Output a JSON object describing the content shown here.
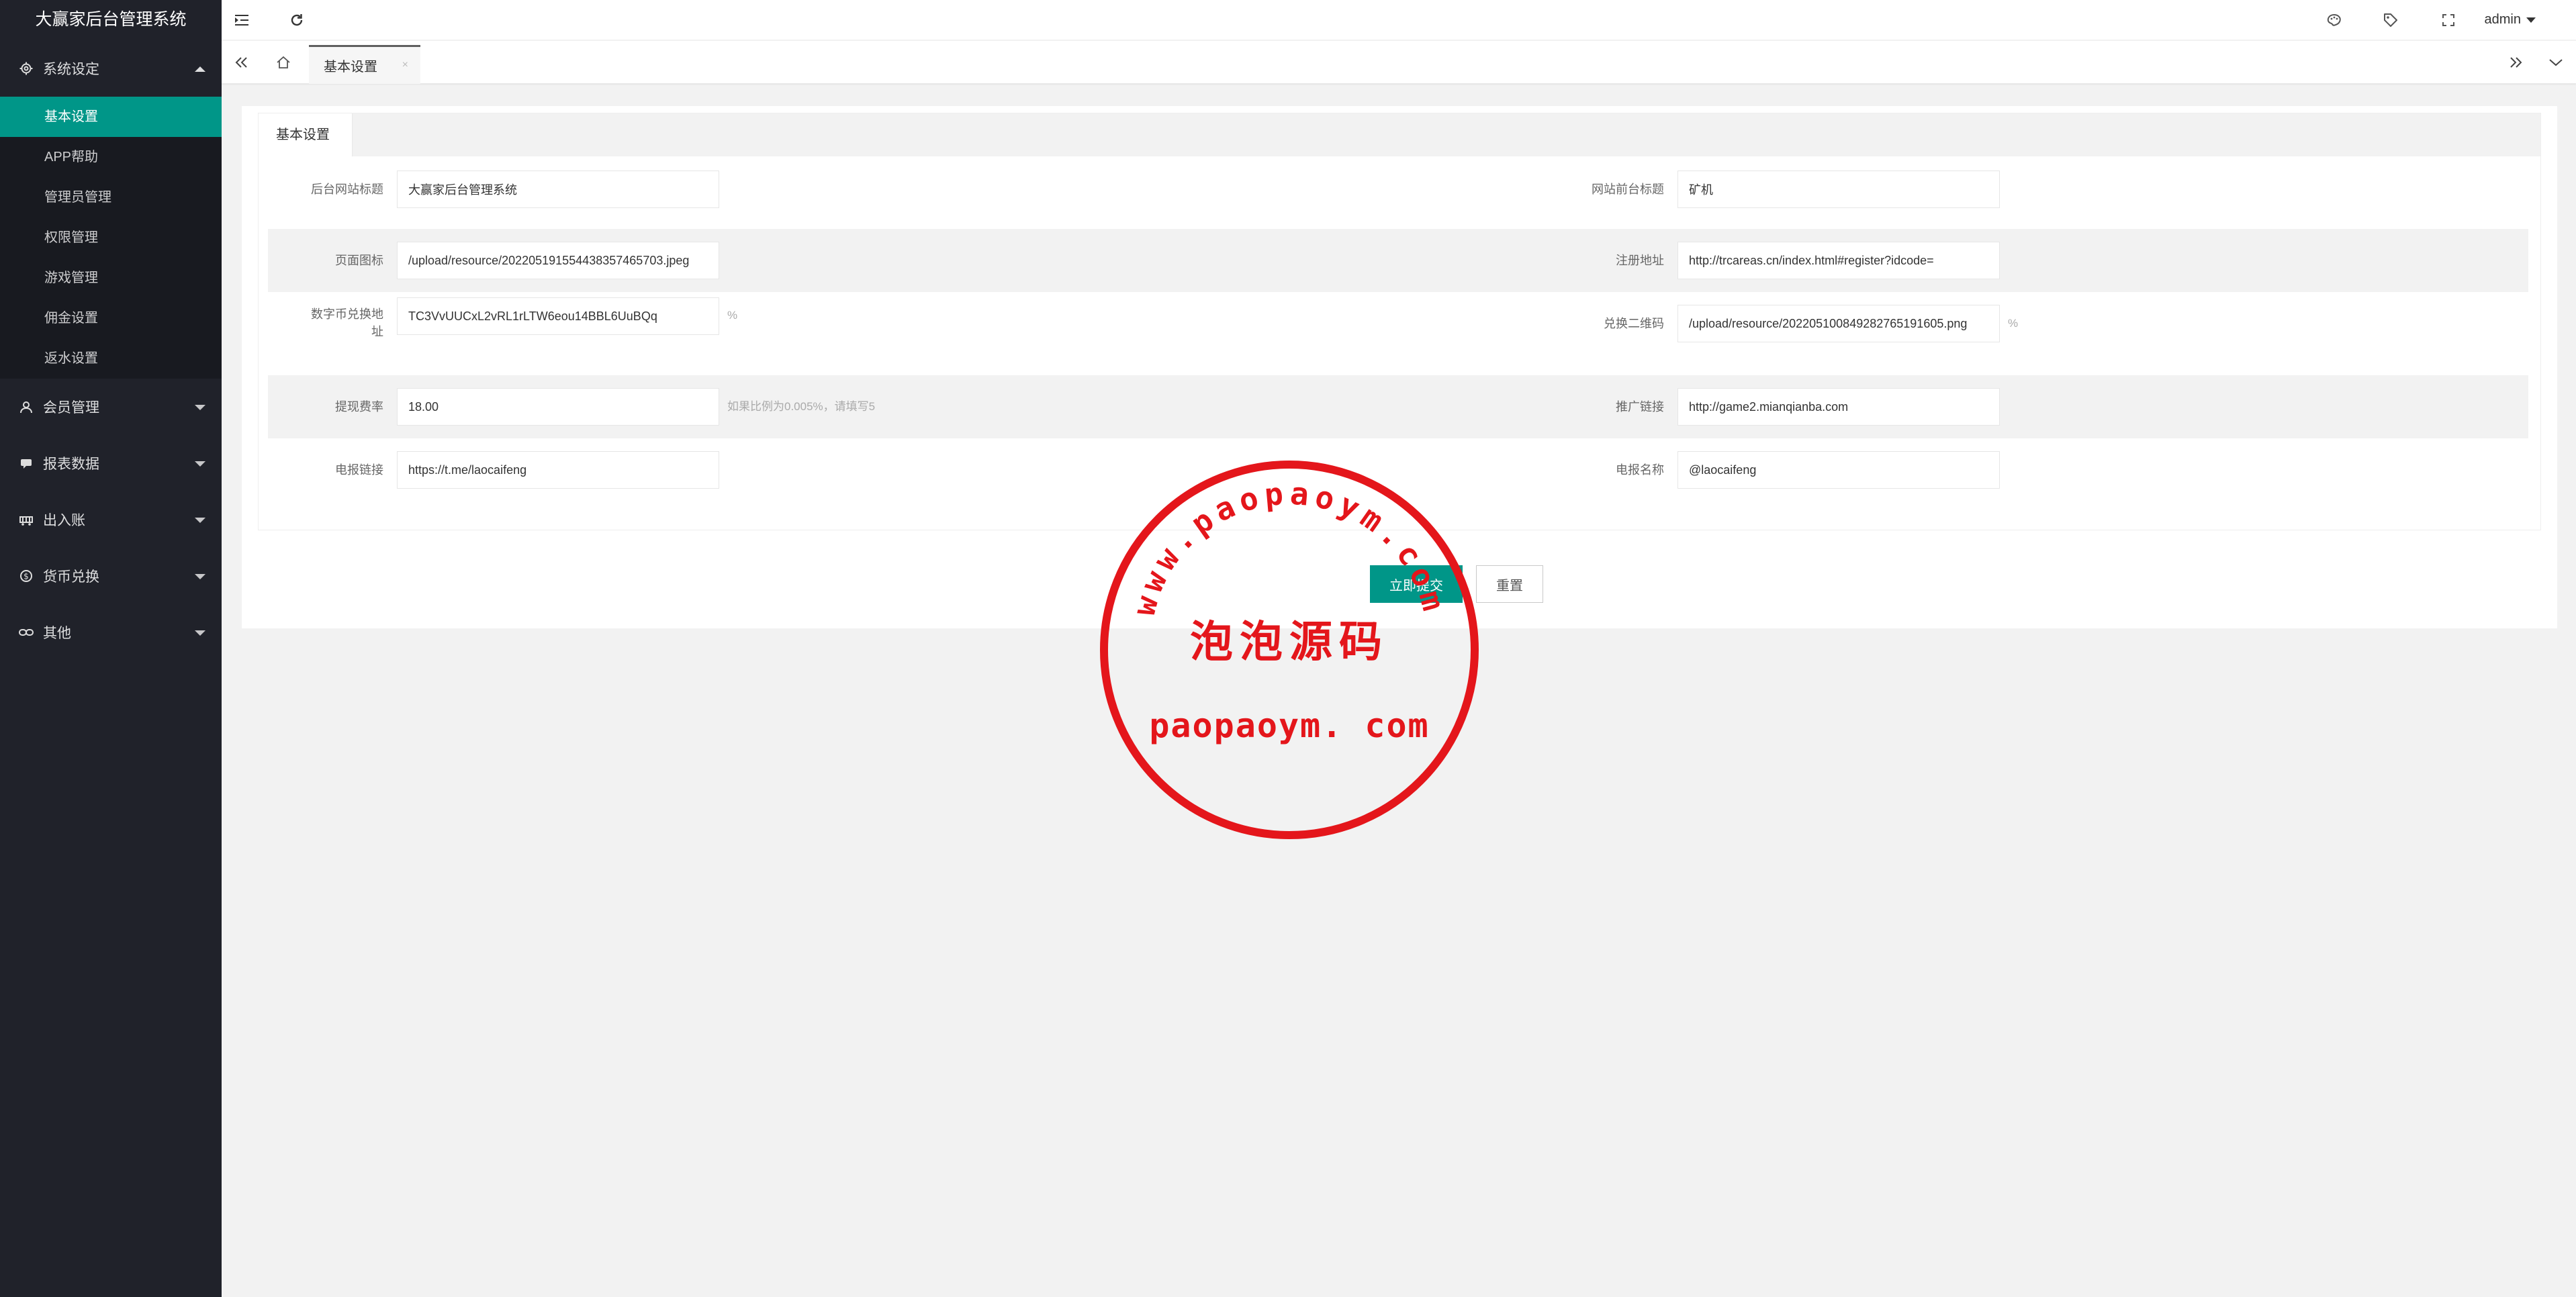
{
  "app": {
    "title": "大赢家后台管理系统"
  },
  "sidebar": {
    "groups": [
      {
        "label": "系统设定",
        "icon": "gear-icon",
        "expanded": true,
        "children": [
          "基本设置",
          "APP帮助",
          "管理员管理",
          "权限管理",
          "游戏管理",
          "佣金设置",
          "返水设置"
        ],
        "active_child": "基本设置"
      },
      {
        "label": "会员管理",
        "icon": "user-icon",
        "expanded": false
      },
      {
        "label": "报表数据",
        "icon": "chat-icon",
        "expanded": false
      },
      {
        "label": "出入账",
        "icon": "cart-icon",
        "expanded": false
      },
      {
        "label": "货币兑换",
        "icon": "dollar-icon",
        "expanded": false
      },
      {
        "label": "其他",
        "icon": "link-icon",
        "expanded": false
      }
    ]
  },
  "header": {
    "icons": [
      "menu-fold-icon",
      "refresh-icon",
      "theme-icon",
      "tag-icon",
      "fullscreen-icon"
    ],
    "user": "admin"
  },
  "tabs": {
    "items": [
      {
        "label": "基本设置",
        "close": "×"
      }
    ]
  },
  "form": {
    "tab_label": "基本设置",
    "fields": {
      "site_admin_title": {
        "label": "后台网站标题",
        "value": "大赢家后台管理系统"
      },
      "site_front_title": {
        "label": "网站前台标题",
        "value": "矿机"
      },
      "page_icon": {
        "label": "页面图标",
        "value": "/upload/resource/20220519155443835746​5703.jpeg"
      },
      "register_url": {
        "label": "注册地址",
        "value": "http://trcareas.cn/index.html#register?idcode="
      },
      "crypto_address": {
        "label_line1": "数字币兑换地",
        "label_line2": "址",
        "value": "TC3VvUUCxL2vRL1rLTW6eou14BBL6UuBQq",
        "suffix": "%"
      },
      "exchange_qrcode": {
        "label": "兑换二维码",
        "value": "/upload/resource/20220510084928276519​1605.png",
        "suffix": "%"
      },
      "withdraw_fee": {
        "label": "提现费率",
        "value": "18.00",
        "hint": "如果比例为0.005%，请填写5"
      },
      "promo_link": {
        "label": "推广链接",
        "value": "http://game2.mianqianba.com"
      },
      "telegram_link": {
        "label": "电报链接",
        "value": "https://t.me/laocaifeng"
      },
      "telegram_name": {
        "label": "电报名称",
        "value": "@laocaifeng"
      }
    },
    "submit_label": "立即提交",
    "reset_label": "重置"
  },
  "watermark": {
    "top_text": "www.paopaoym.com",
    "middle_text": "泡泡源码",
    "bottom_text": "paopaoym. com",
    "color": "#e4161b"
  },
  "colors": {
    "accent": "#009688",
    "sidebar_bg": "#20222a",
    "sidebar_sub_bg": "#181a20"
  }
}
